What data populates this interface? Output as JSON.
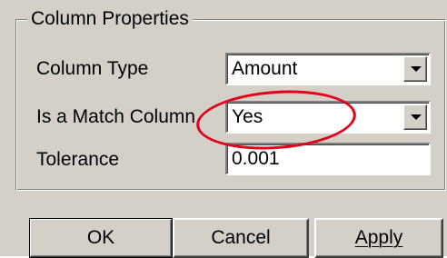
{
  "group": {
    "title": "Column Properties"
  },
  "fields": {
    "column_type": {
      "label": "Column Type",
      "value": "Amount"
    },
    "is_match": {
      "label": "Is a Match Column",
      "value": "Yes"
    },
    "tolerance": {
      "label": "Tolerance",
      "value": "0.001"
    }
  },
  "buttons": {
    "ok": "OK",
    "cancel": "Cancel",
    "apply": "Apply"
  },
  "colors": {
    "annotation": "#e3001b",
    "dialog": "#d4d0c8"
  }
}
